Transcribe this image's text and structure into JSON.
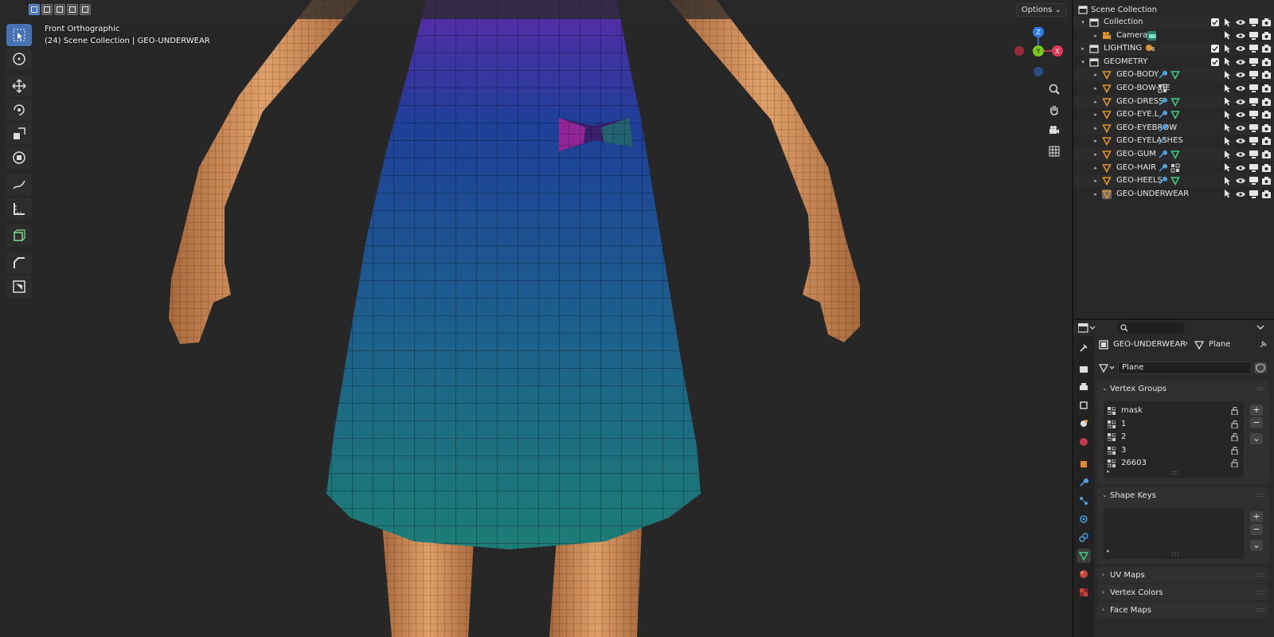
{
  "viewport": {
    "view_name": "Front Orthographic",
    "collection_info": "(24) Scene Collection | GEO-UNDERWEAR",
    "options_label": "Options ⌄",
    "gizmo": {
      "z": "Z",
      "y": "Y",
      "x": "X"
    },
    "colors": {
      "background": "#272727",
      "skin": "#c98b57",
      "dress_top": "#5a2ea6",
      "dress_bottom": "#1f7a78",
      "bow": "#b02aa8"
    }
  },
  "toolbar": {
    "tools": [
      "select-box",
      "cursor",
      "move",
      "rotate",
      "scale",
      "transform",
      "annotate",
      "measure",
      "add-cube",
      "bevel",
      "extrude"
    ]
  },
  "outliner": {
    "root": "Scene Collection",
    "rows": [
      {
        "label": "Collection",
        "kind": "collection",
        "level": 1,
        "checked": true
      },
      {
        "label": "Camera",
        "kind": "camera",
        "level": 2
      },
      {
        "label": "LIGHTING",
        "kind": "collection",
        "level": 1,
        "checked": true,
        "badge": "6"
      },
      {
        "label": "GEOMETRY",
        "kind": "collection",
        "level": 1,
        "checked": true
      },
      {
        "label": "GEO-BODY",
        "kind": "mesh",
        "level": 2,
        "mods": [
          "wrench",
          "mesh"
        ]
      },
      {
        "label": "GEO-BOW-TIE",
        "kind": "mesh",
        "level": 2,
        "mods": [
          "group"
        ]
      },
      {
        "label": "GEO-DRESS",
        "kind": "mesh",
        "level": 2,
        "mods": [
          "wrench",
          "mesh"
        ]
      },
      {
        "label": "GEO-EYE.L",
        "kind": "mesh",
        "level": 2,
        "mods": [
          "wrench",
          "mesh"
        ]
      },
      {
        "label": "GEO-EYEBROW",
        "kind": "mesh",
        "level": 2,
        "mods": [
          "wrench"
        ]
      },
      {
        "label": "GEO-EYELASHES",
        "kind": "mesh",
        "level": 2,
        "mods": [
          "curve"
        ]
      },
      {
        "label": "GEO-GUM",
        "kind": "mesh",
        "level": 2,
        "mods": [
          "wrench",
          "mesh"
        ]
      },
      {
        "label": "GEO-HAIR",
        "kind": "mesh",
        "level": 2,
        "mods": [
          "wrench",
          "group"
        ]
      },
      {
        "label": "GEO-HEELS",
        "kind": "mesh",
        "level": 2,
        "mods": [
          "wrench",
          "mesh"
        ]
      },
      {
        "label": "GEO-UNDERWEAR",
        "kind": "mesh",
        "level": 2,
        "active": true,
        "mods": []
      }
    ]
  },
  "properties": {
    "search_placeholder": "",
    "breadcrumb_object": "GEO-UNDERWEAR",
    "breadcrumb_sep": "›",
    "breadcrumb_data": "Plane",
    "mesh_name": "Plane",
    "vertex_groups_title": "Vertex Groups",
    "vertex_groups": [
      "mask",
      "1",
      "2",
      "3",
      "26603"
    ],
    "shape_keys_title": "Shape Keys",
    "collapsed_panels": [
      "UV Maps",
      "Vertex Colors",
      "Face Maps"
    ],
    "add_label": "+",
    "remove_label": "−",
    "menu_label": "⌄",
    "expand_label": "▸",
    "grip_label": "::::"
  }
}
